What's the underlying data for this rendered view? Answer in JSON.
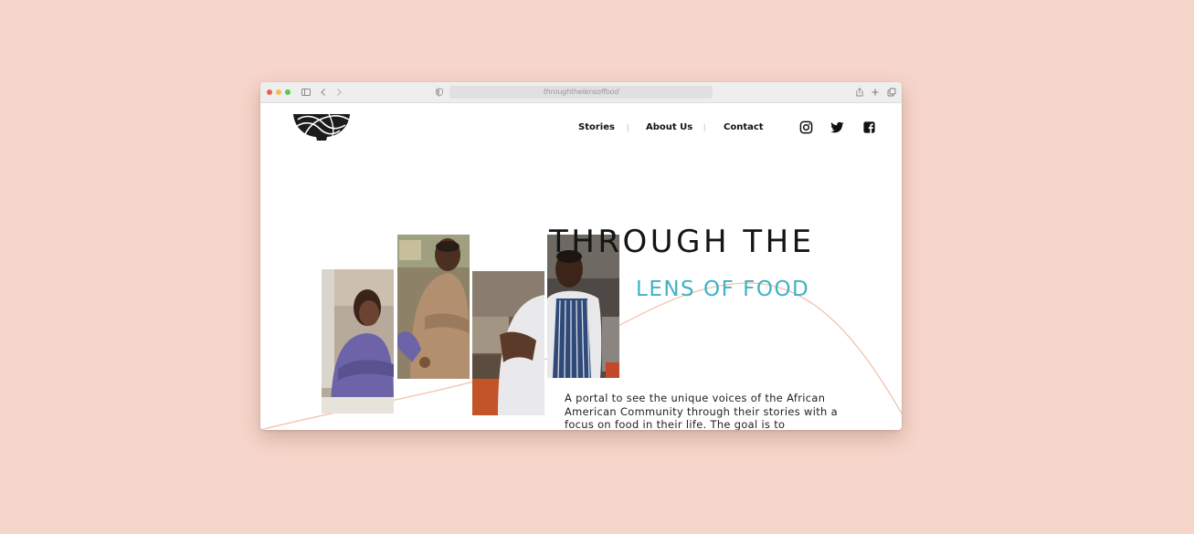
{
  "browser": {
    "url": "throughthelensoffood"
  },
  "header": {
    "logo_icon": "bowl-logo-icon",
    "nav": [
      {
        "label": "Stories"
      },
      {
        "label": "About Us"
      },
      {
        "label": "Contact"
      }
    ],
    "social": [
      {
        "icon": "instagram-icon"
      },
      {
        "icon": "twitter-icon"
      },
      {
        "icon": "facebook-icon"
      }
    ]
  },
  "hero": {
    "title_line1": "THROUGH THE",
    "title_line2": "LENS OF FOOD",
    "description": "A portal to see the unique voices of the African American Community through their stories with a focus on food in their life. The goal is to",
    "accent_color": "#3fb3c3",
    "curve_color": "#f3c2ae"
  }
}
